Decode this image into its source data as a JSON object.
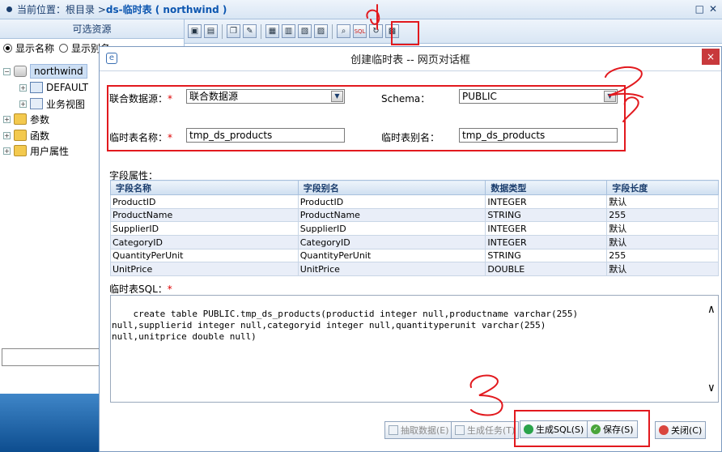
{
  "breadcrumb": {
    "prefix": "当前位置：根目录 > ",
    "current": "ds-临时表 ( northwind )"
  },
  "left": {
    "header": "可选资源",
    "radio_show_name": "显示名称",
    "radio_show_alias": "显示别名",
    "tree": [
      {
        "label": "northwind",
        "icon": "database-icon",
        "selected": true
      },
      {
        "label": "DEFAULT",
        "icon": "table-icon"
      },
      {
        "label": "业务视图",
        "icon": "view-icon"
      },
      {
        "label": "参数",
        "icon": "parameter-icon"
      },
      {
        "label": "函数",
        "icon": "function-icon"
      },
      {
        "label": "用户属性",
        "icon": "user-attribute-icon"
      }
    ]
  },
  "toolbar": {
    "sql_label": "SQL"
  },
  "dialog": {
    "title": "创建临时表 -- 网页对话框",
    "close": "×",
    "fed_source_label": "联合数据源：",
    "fed_source_value": "联合数据源",
    "schema_label": "Schema：",
    "schema_value": "PUBLIC",
    "tmp_name_label": "临时表名称：",
    "tmp_name_value": "tmp_ds_products",
    "tmp_alias_label": "临时表别名：",
    "tmp_alias_value": "tmp_ds_products",
    "req_mark": "*",
    "field_props_label": "字段属性：",
    "columns": [
      "字段名称",
      "字段别名",
      "数据类型",
      "字段长度"
    ],
    "rows": [
      [
        "ProductID",
        "ProductID",
        "INTEGER",
        "默认"
      ],
      [
        "ProductName",
        "ProductName",
        "STRING",
        "255"
      ],
      [
        "SupplierID",
        "SupplierID",
        "INTEGER",
        "默认"
      ],
      [
        "CategoryID",
        "CategoryID",
        "INTEGER",
        "默认"
      ],
      [
        "QuantityPerUnit",
        "QuantityPerUnit",
        "STRING",
        "255"
      ],
      [
        "UnitPrice",
        "UnitPrice",
        "DOUBLE",
        "默认"
      ]
    ],
    "sql_label": "临时表SQL：",
    "sql_text": "create table PUBLIC.tmp_ds_products(productid integer null,productname varchar(255)\nnull,supplierid integer null,categoryid integer null,quantityperunit varchar(255)\nnull,unitprice double null)",
    "buttons": {
      "extract": "抽取数据(E)",
      "gen_task": "生成任务(T)",
      "gen_sql": "生成SQL(S)",
      "save": "保存(S)",
      "close": "关闭(C)"
    }
  },
  "annotations": {
    "color": "#e2191e"
  }
}
